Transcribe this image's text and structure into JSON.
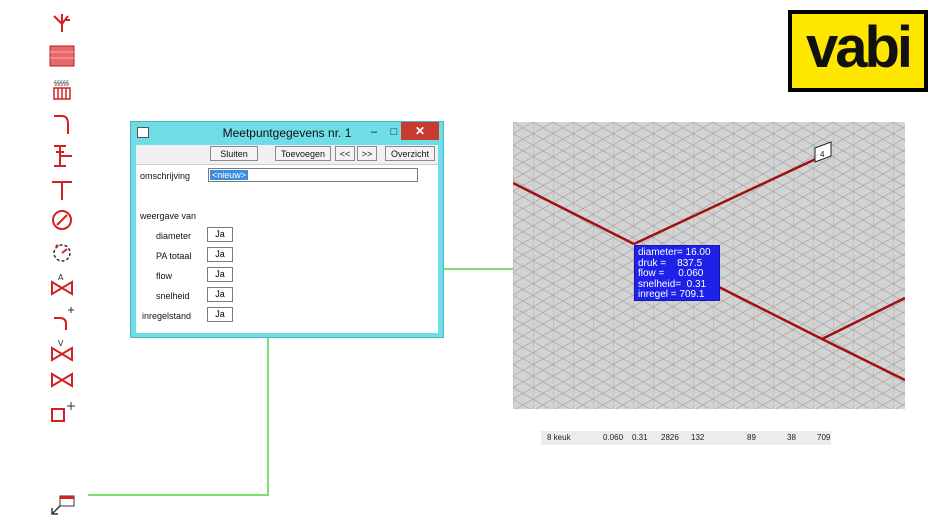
{
  "toolbar_icons": [
    "pipe-branch-icon",
    "radiator-icon",
    "heater-icon",
    "pipe-bend-icon",
    "pump-icon",
    "tee-icon",
    "meter-gauge-icon",
    "pressure-gauge-icon",
    "auto-valve-icon",
    "bend-add-icon",
    "check-valve-icon",
    "valve-icon",
    "add-node-icon"
  ],
  "logo": {
    "text": "vabi",
    "bg_color": "#ffe600"
  },
  "dialog": {
    "title": "Meetpuntgegevens nr. 1",
    "minimize": "–",
    "maximize": "□",
    "close": "✕",
    "buttons": {
      "sluiten": "Sluiten",
      "toevoegen": "Toevoegen",
      "prev": "<<",
      "next": ">>",
      "overzicht": "Overzicht"
    },
    "omschrijving_label": "omschrijving",
    "omschrijving_value": "<nieuw>",
    "weergave_label": "weergave van",
    "rows": [
      {
        "label": "diameter",
        "value": "Ja"
      },
      {
        "label": "PA totaal",
        "value": "Ja"
      },
      {
        "label": "flow",
        "value": "Ja"
      },
      {
        "label": "snelheid",
        "value": "Ja"
      },
      {
        "label": "inregelstand",
        "value": "Ja"
      }
    ]
  },
  "canvas": {
    "node_label": "4",
    "info_lines": [
      "diameter= 16.00",
      "druk =    837.5",
      "flow =     0.060",
      "snelheid=  0.31",
      "inregel = 709.1"
    ],
    "pipe_color": "#a01212",
    "grid_bg": "#d3d3d3",
    "info_bg": "#1e22e8"
  },
  "data_row": [
    "8 keuk",
    "0.060",
    "0.31",
    "2826",
    "132",
    "89",
    "38",
    "709"
  ],
  "connector_color": "#7ddf72"
}
